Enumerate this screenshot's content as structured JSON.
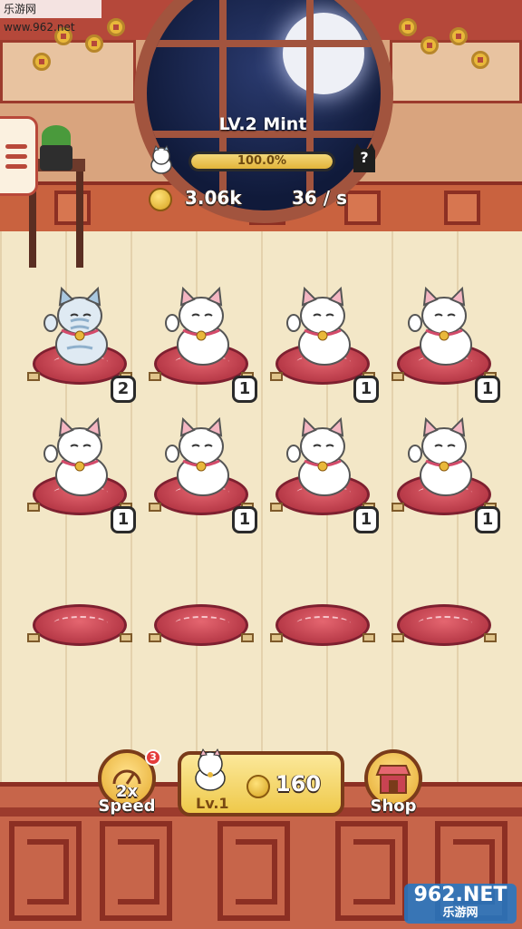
{
  "watermark": {
    "top": "乐游网 www.962.net",
    "brand": "962.NET",
    "brand_sub": "乐游网"
  },
  "header": {
    "level_title": "LV.2  Mint",
    "progress_text": "100.0%",
    "progress_value": 1.0,
    "next_unknown": "?",
    "coins": "3.06k",
    "rate": "36 / s"
  },
  "grid": {
    "rows": [
      [
        {
          "cat": "tabby",
          "level": "2"
        },
        {
          "cat": "white",
          "level": "1"
        },
        {
          "cat": "white",
          "level": "1"
        },
        {
          "cat": "white",
          "level": "1"
        }
      ],
      [
        {
          "cat": "white",
          "level": "1"
        },
        {
          "cat": "white",
          "level": "1"
        },
        {
          "cat": "white",
          "level": "1"
        },
        {
          "cat": "white",
          "level": "1"
        }
      ],
      [
        {
          "cat": "",
          "level": ""
        },
        {
          "cat": "",
          "level": ""
        },
        {
          "cat": "",
          "level": ""
        },
        {
          "cat": "",
          "level": ""
        }
      ]
    ]
  },
  "footer": {
    "speed": {
      "icon_text": "2x",
      "label": "Speed",
      "badge": "3"
    },
    "buy": {
      "level": "Lv.1",
      "price": "160"
    },
    "shop": {
      "label": "Shop"
    }
  },
  "colors": {
    "accent": "#b9493a",
    "gold": "#e4a92c",
    "cushion": "#c94352"
  },
  "icons": {
    "menu": "hamburger-icon",
    "coin": "gold-coin-icon",
    "speed": "speedometer-icon",
    "shop": "shop-stall-icon"
  }
}
